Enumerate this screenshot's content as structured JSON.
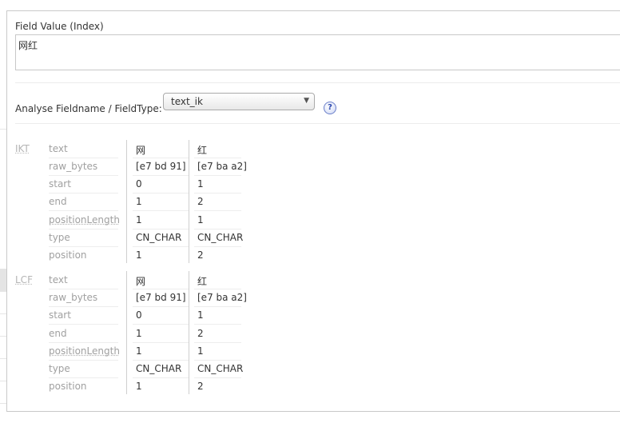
{
  "field_value": {
    "label": "Field Value (Index)",
    "value": "网红"
  },
  "analyse": {
    "label": "Analyse Fieldname / FieldType:",
    "selected": "text_ik",
    "help": "?"
  },
  "analyses": [
    {
      "name": "IKT",
      "rows": [
        {
          "key": "text",
          "v1": "网",
          "v2": "红"
        },
        {
          "key": "raw_bytes",
          "v1": "[e7 bd 91]",
          "v2": "[e7 ba a2]"
        },
        {
          "key": "start",
          "v1": "0",
          "v2": "1"
        },
        {
          "key": "end",
          "v1": "1",
          "v2": "2"
        },
        {
          "key": "positionLength",
          "v1": "1",
          "v2": "1"
        },
        {
          "key": "type",
          "v1": "CN_CHAR",
          "v2": "CN_CHAR"
        },
        {
          "key": "position",
          "v1": "1",
          "v2": "2"
        }
      ]
    },
    {
      "name": "LCF",
      "rows": [
        {
          "key": "text",
          "v1": "网",
          "v2": "红"
        },
        {
          "key": "raw_bytes",
          "v1": "[e7 bd 91]",
          "v2": "[e7 ba a2]"
        },
        {
          "key": "start",
          "v1": "0",
          "v2": "1"
        },
        {
          "key": "end",
          "v1": "1",
          "v2": "2"
        },
        {
          "key": "positionLength",
          "v1": "1",
          "v2": "1"
        },
        {
          "key": "type",
          "v1": "CN_CHAR",
          "v2": "CN_CHAR"
        },
        {
          "key": "position",
          "v1": "1",
          "v2": "2"
        }
      ]
    }
  ]
}
